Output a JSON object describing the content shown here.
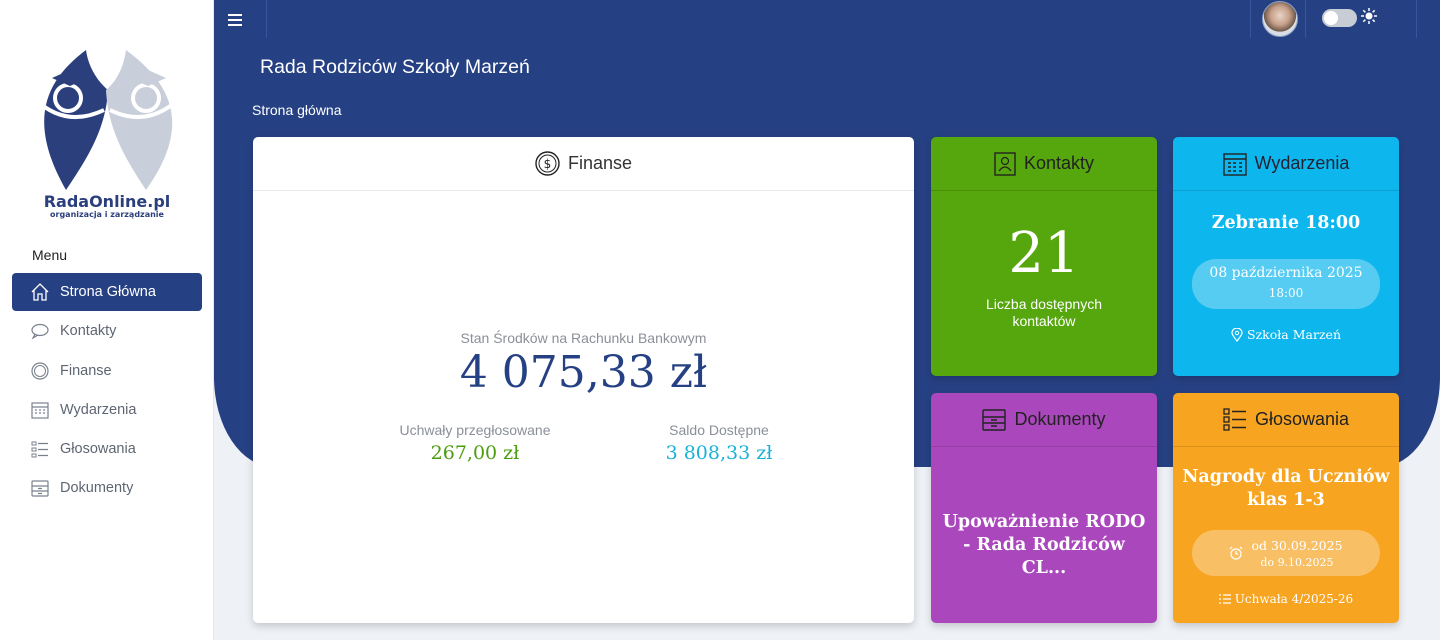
{
  "brand": {
    "name": "RadaOnline.pl",
    "tagline": "organizacja i zarządzanie"
  },
  "sidebar": {
    "menu_title": "Menu",
    "items": [
      {
        "label": "Strona Główna",
        "icon": "home-icon",
        "active": true
      },
      {
        "label": "Kontakty",
        "icon": "chat-icon"
      },
      {
        "label": "Finanse",
        "icon": "coin-icon"
      },
      {
        "label": "Wydarzenia",
        "icon": "calendar-icon"
      },
      {
        "label": "Głosowania",
        "icon": "checklist-icon"
      },
      {
        "label": "Dokumenty",
        "icon": "archive-icon"
      }
    ]
  },
  "header": {
    "title": "Rada Rodziców Szkoły Marzeń",
    "breadcrumb": "Strona główna"
  },
  "finance": {
    "title": "Finanse",
    "balance_label": "Stan Środków na Rachunku Bankowym",
    "balance": "4 075,33 zł",
    "voted_label": "Uchwały przegłosowane",
    "voted": "267,00 zł",
    "available_label": "Saldo Dostępne",
    "available": "3 808,33 zł"
  },
  "contacts": {
    "title": "Kontakty",
    "count": "21",
    "caption": "Liczba dostępnych kontaktów"
  },
  "events": {
    "title": "Wydarzenia",
    "name": "Zebranie 18:00",
    "date": "08 października 2025",
    "time": "18:00",
    "location": "Szkoła Marzeń"
  },
  "documents": {
    "title": "Dokumenty",
    "name": "Upoważnienie RODO - Rada Rodziców CL..."
  },
  "votes": {
    "title": "Głosowania",
    "name": "Nagrody dla Uczniów klas 1-3",
    "from": "od 30.09.2025",
    "to": "do 9.10.2025",
    "resolution": "Uchwała 4/2025-26"
  },
  "colors": {
    "primary": "#264183",
    "green": "#56a60d",
    "cyan": "#0db7ee",
    "purple": "#ab47bc",
    "orange": "#f7a421",
    "voted": "#4b9c0f",
    "available": "#19b2d6"
  }
}
